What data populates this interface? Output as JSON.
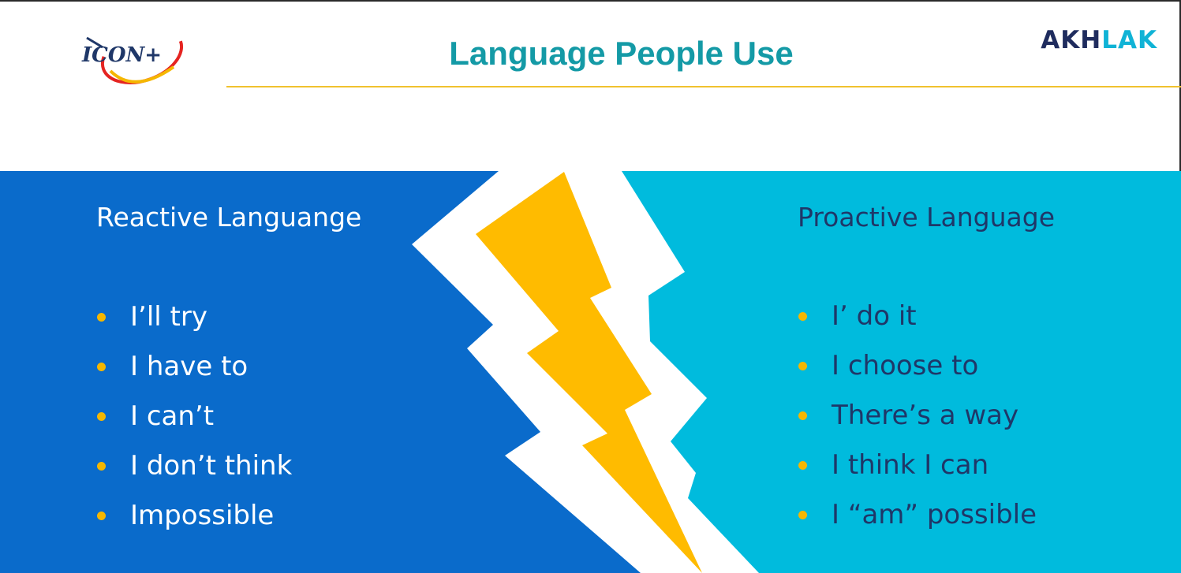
{
  "slide": {
    "title": "Language People Use",
    "logos": {
      "left_text": "ICON+",
      "right_part1": "AKH",
      "right_part2": "LAK"
    },
    "left_panel": {
      "heading": "Reactive Languange",
      "items": [
        {
          "text": "I’ll try"
        },
        {
          "text": "I have to"
        },
        {
          "text": "I can’t"
        },
        {
          "text": "I don’t think"
        },
        {
          "text": "Impossible"
        }
      ]
    },
    "right_panel": {
      "heading": "Proactive Language",
      "items": [
        {
          "text": "I’ do it"
        },
        {
          "text": "I choose to"
        },
        {
          "text": "There’s a way"
        },
        {
          "text": "I think I can"
        },
        {
          "text": "I “am” possible"
        }
      ]
    }
  },
  "colors": {
    "left_panel": "#0a6bcb",
    "right_panel": "#00bbdd",
    "bolt": "#ffbb00",
    "title": "#149aa6",
    "accent_line": "#f0c22e",
    "bullet": "#f5b700",
    "right_text": "#1f3768"
  },
  "icons": [
    "icon-plus-logo",
    "lightning-bolt-icon",
    "bullet-dot-icon"
  ]
}
